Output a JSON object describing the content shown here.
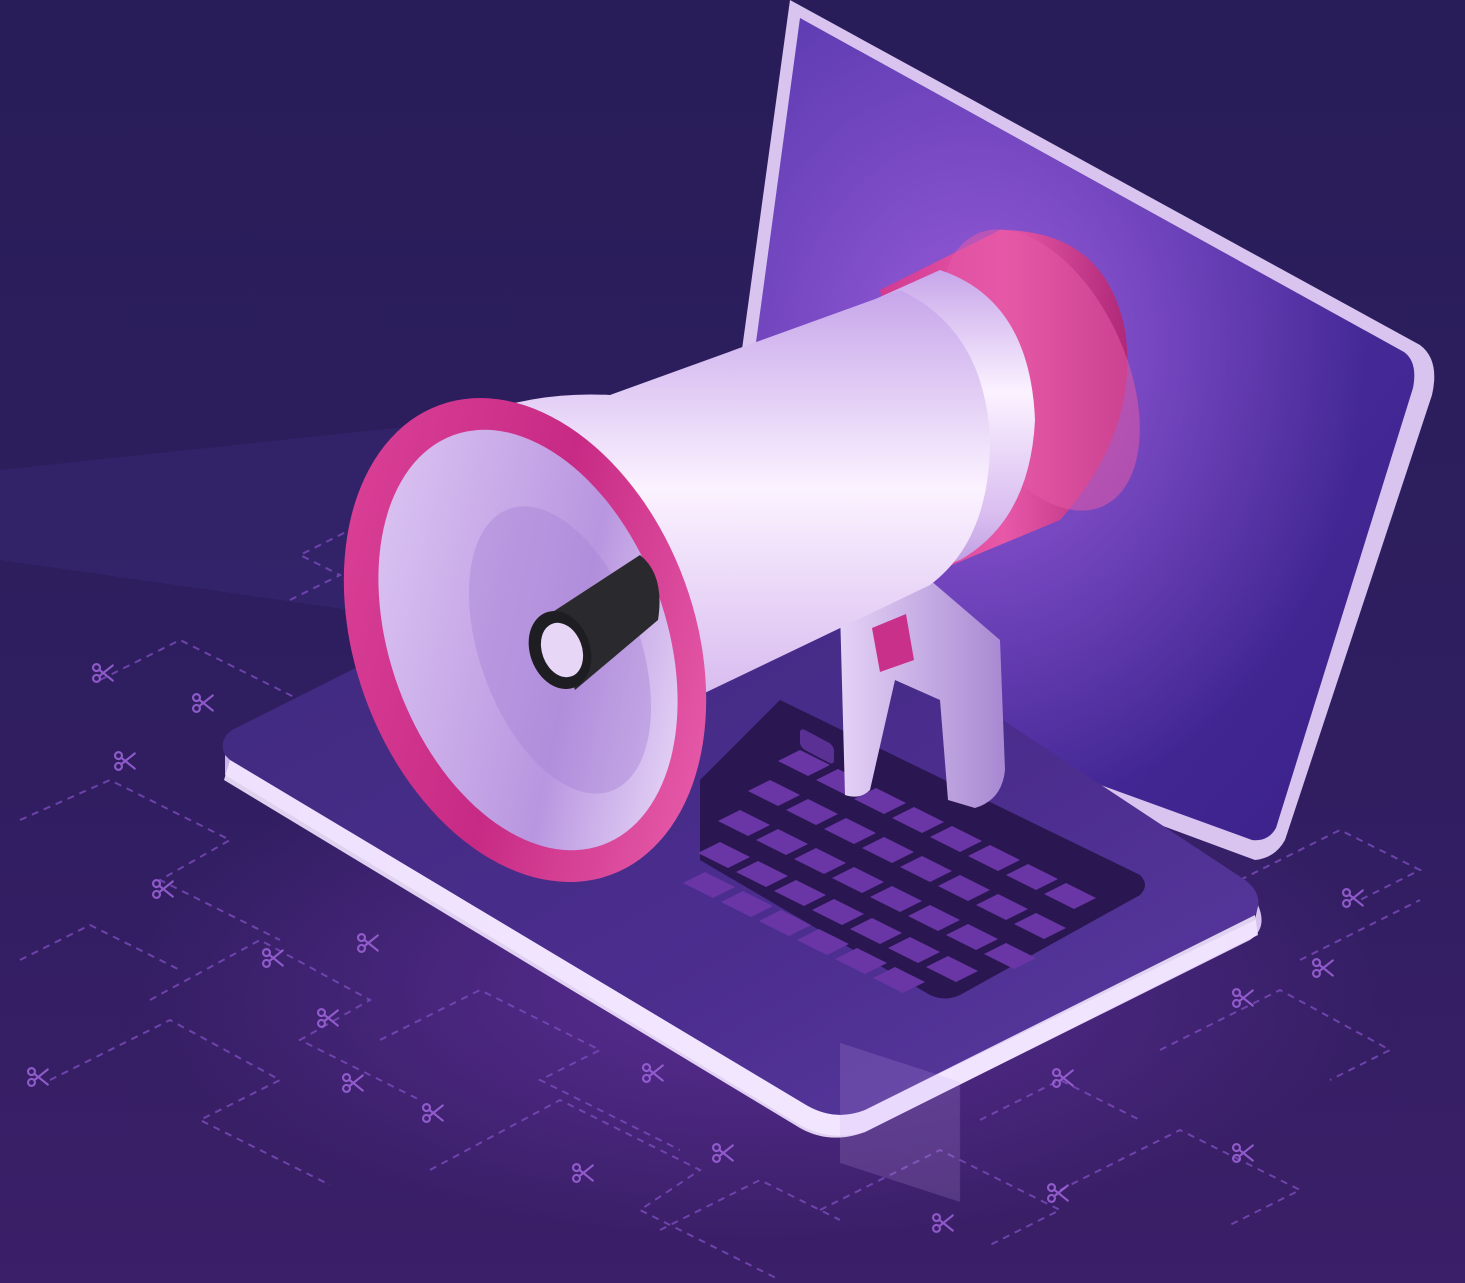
{
  "illustration": {
    "subject": "megaphone-on-laptop",
    "elements": [
      "laptop-screen",
      "laptop-base",
      "keyboard",
      "megaphone",
      "circuit-scissors-pattern"
    ],
    "palette": {
      "background_top": "#2a1f5c",
      "background_bottom": "#3a1f66",
      "screen": "#4a2d9c",
      "screen_glow": "#7a48d8",
      "laptop_edge": "#e8d8f8",
      "keyboard_tray": "#2a1550",
      "key": "#5a2f9a",
      "megaphone_body": "#ecdcf6",
      "megaphone_ring": "#d6338c",
      "megaphone_mouthpiece": "#2a2a2a",
      "circuit_line": "#7a4ab8",
      "scissors_icon": "#9a62d6"
    }
  }
}
